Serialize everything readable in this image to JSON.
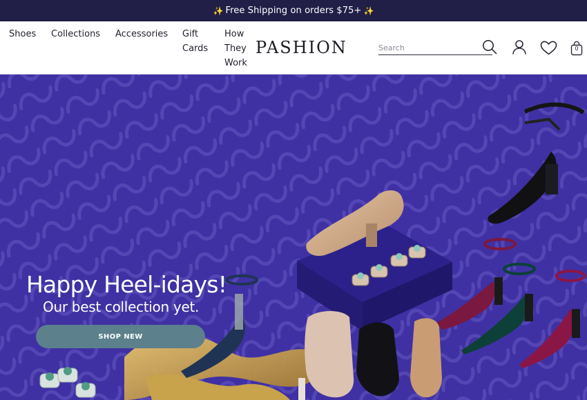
{
  "promo": {
    "sparkle": "✨",
    "text": "Free Shipping on orders $75+"
  },
  "nav": {
    "shoes": "Shoes",
    "collections": "Collections",
    "accessories": "Accessories",
    "gift_line1": "Gift",
    "gift_line2": "Cards",
    "how_line1": "How",
    "how_line2": "They",
    "how_line3": "Work"
  },
  "logo": "PASHION",
  "search": {
    "placeholder": "Search",
    "value": ""
  },
  "icons": {
    "search": "search-icon",
    "account": "user-icon",
    "wishlist": "heart-icon",
    "bag": "shopping-bag-icon"
  },
  "bag": {
    "count": "0"
  },
  "hero": {
    "title": "Happy Heel-idays!",
    "subtitle": "Our best collection yet.",
    "cta": "SHOP NEW"
  },
  "colors": {
    "promo_bg": "#211f47",
    "hero_bg": "#3f31a3",
    "cta_bg": "#5c808c"
  }
}
